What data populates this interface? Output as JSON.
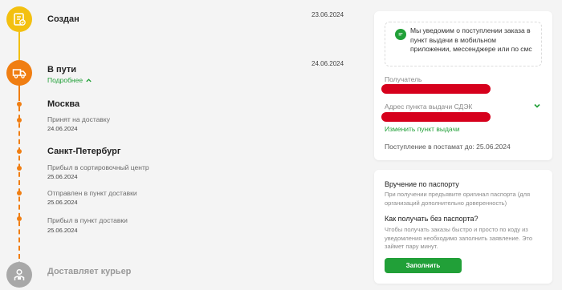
{
  "colors": {
    "accent_green": "#21a038",
    "status_yellow": "#f3c010",
    "status_orange": "#f07e12",
    "status_gray": "#a8a8a8",
    "redaction_red": "#d6001c"
  },
  "timeline": {
    "created": {
      "title": "Создан",
      "date": "23.06.2024",
      "icon": "document-check-icon"
    },
    "in_transit": {
      "title": "В пути",
      "date": "24.06.2024",
      "more_label": "Подробнее",
      "icon": "truck-icon",
      "expanded": true
    },
    "cities": [
      {
        "name": "Москва",
        "events": [
          {
            "text": "Принят на доставку",
            "date": "24.06.2024"
          }
        ]
      },
      {
        "name": "Санкт-Петербург",
        "events": [
          {
            "text": "Прибыл в сортировочный центр",
            "date": "25.06.2024"
          },
          {
            "text": "Отправлен в пункт доставки",
            "date": "25.06.2024"
          },
          {
            "text": "Прибыл в пункт доставки",
            "date": "25.06.2024"
          }
        ]
      }
    ],
    "courier": {
      "title": "Доставляет курьер",
      "icon": "courier-icon"
    }
  },
  "info_card": {
    "notify_text": "Мы уведомим о поступлении заказа в пункт выдачи в мобильном приложении, мессенджере или по смс",
    "recipient_label": "Получатель",
    "pickup_address_label": "Адрес пункта выдачи СДЭК",
    "change_pickup_link": "Изменить пункт выдачи",
    "arrival_text": "Поступление в постамат до: 25.06.2024"
  },
  "passport_card": {
    "title": "Вручение по паспорту",
    "note": "При получении предъявите оригинал паспорта (для организаций дополнительно доверенность)",
    "question": "Как получать без паспорта?",
    "explain": "Чтобы получать заказы быстро и просто по коду из уведомления необходимо заполнить заявление. Это займет пару минут.",
    "fill_button": "Заполнить"
  }
}
